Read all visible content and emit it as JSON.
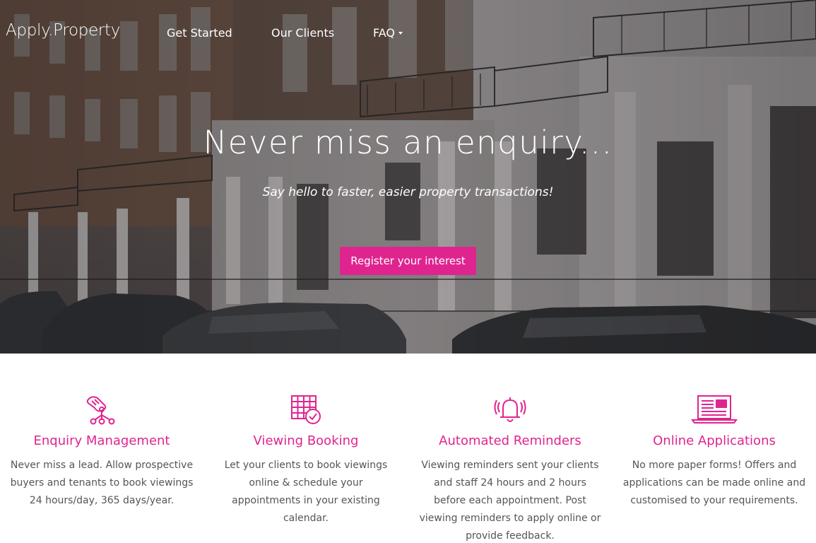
{
  "brand": {
    "name": "Apply.Property"
  },
  "nav": {
    "items": [
      {
        "label": "Get Started"
      },
      {
        "label": "Our Clients"
      },
      {
        "label": "FAQ"
      }
    ]
  },
  "hero": {
    "headline": "Never miss an enquiry...",
    "subheadline": "Say hello to faster, easier property transactions!",
    "cta_label": "Register your interest"
  },
  "features": [
    {
      "icon": "handshake-network-icon",
      "title": "Enquiry Management",
      "text": "Never miss a lead. Allow prospective buyers and tenants to book viewings 24 hours/day, 365 days/year."
    },
    {
      "icon": "calendar-check-icon",
      "title": "Viewing Booking",
      "text": "Let your clients to book viewings online & schedule your appointments in your existing calendar."
    },
    {
      "icon": "bell-ringing-icon",
      "title": "Automated Reminders",
      "text": "Viewing reminders sent your clients and staff 24 hours and 2 hours before each appointment. Post viewing reminders to apply online or provide feedback."
    },
    {
      "icon": "laptop-form-icon",
      "title": "Online Applications",
      "text": "No more paper forms! Offers and applications can be made online and customised to your requirements."
    }
  ],
  "colors": {
    "accent": "#e0248f",
    "body_text": "#555555",
    "hero_overlay": "#3b3a3c"
  }
}
